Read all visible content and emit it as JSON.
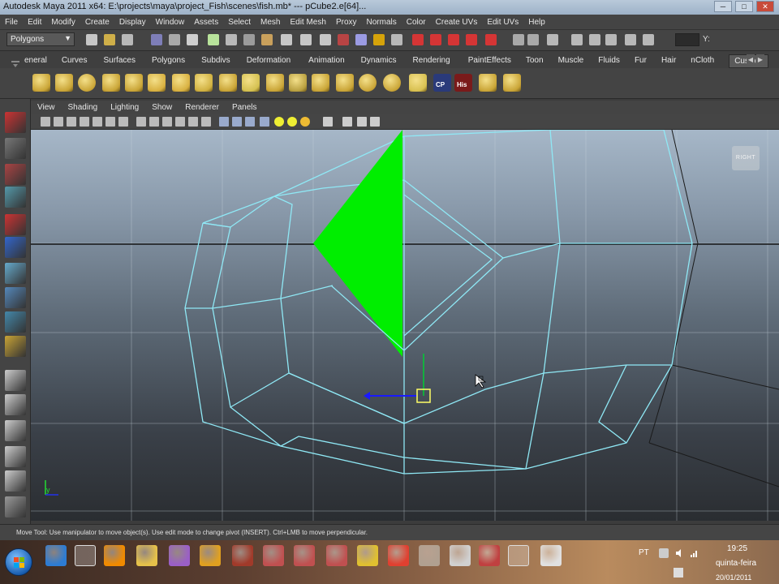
{
  "window": {
    "title": "Autodesk Maya 2011 x64: E:\\projects\\maya\\project_Fish\\scenes\\fish.mb*  ---  pCube2.e[64]...",
    "minimize": "─",
    "maximize": "□",
    "close": "✕"
  },
  "menubar": [
    "File",
    "Edit",
    "Modify",
    "Create",
    "Display",
    "Window",
    "Assets",
    "Select",
    "Mesh",
    "Edit Mesh",
    "Proxy",
    "Normals",
    "Color",
    "Create UVs",
    "Edit UVs",
    "Help"
  ],
  "statusline": {
    "mode": "Polygons",
    "coord_label": "Y:"
  },
  "shelf_tabs": {
    "items": [
      "eneral",
      "Curves",
      "Surfaces",
      "Polygons",
      "Subdivs",
      "Deformation",
      "Animation",
      "Dynamics",
      "Rendering",
      "PaintEffects",
      "Toon",
      "Muscle",
      "Fluids",
      "Fur",
      "Hair",
      "nCloth",
      "Custom"
    ],
    "active": "Custom"
  },
  "shelf_icons": [
    "poly-cylinder-icon",
    "poly-cube-icon",
    "poly-sphere-icon",
    "poly-cylinder-icon",
    "poly-plane-icon",
    "extrude-icon",
    "split-icon",
    "append-icon",
    "bevel-icon",
    "smooth-icon",
    "combine-icon",
    "separate-icon",
    "merge-icon",
    "mirror-icon",
    "sphere-icon",
    "soccer-ball-icon",
    "grid-icon",
    "cp-icon",
    "his-icon",
    "layout-icon",
    "uv-icon"
  ],
  "shelf_labels": {
    "cp": "CP",
    "his": "His"
  },
  "panel_menu": [
    "View",
    "Shading",
    "Lighting",
    "Show",
    "Renderer",
    "Panels"
  ],
  "viewport": {
    "camera": "RIGHT",
    "axis_label": "y",
    "colors": {
      "wire": "#8fe8f5",
      "face": "#00ee00",
      "pivot": "#ffff66",
      "manip_z": "#1a1aff",
      "horizon": "#111111"
    }
  },
  "helpline": "Move Tool: Use manipulator to move object(s). Use edit mode to change pivot (INSERT).  Ctrl+LMB to move perpendicular.",
  "taskbar": {
    "apps": [
      "ie-icon",
      "firefox-icon",
      "vlc-icon",
      "explorer-folder-icon",
      "media-icon",
      "pdf-icon",
      "illustrator-icon",
      "app-icon",
      "app-icon",
      "app-icon",
      "app-icon",
      "chrome-icon",
      "app-icon",
      "app-icon",
      "paint-icon",
      "maya-icon",
      "calculator-icon"
    ],
    "language": "PT",
    "time": "19:25",
    "day": "quinta-feira",
    "date": "20/01/2011"
  }
}
